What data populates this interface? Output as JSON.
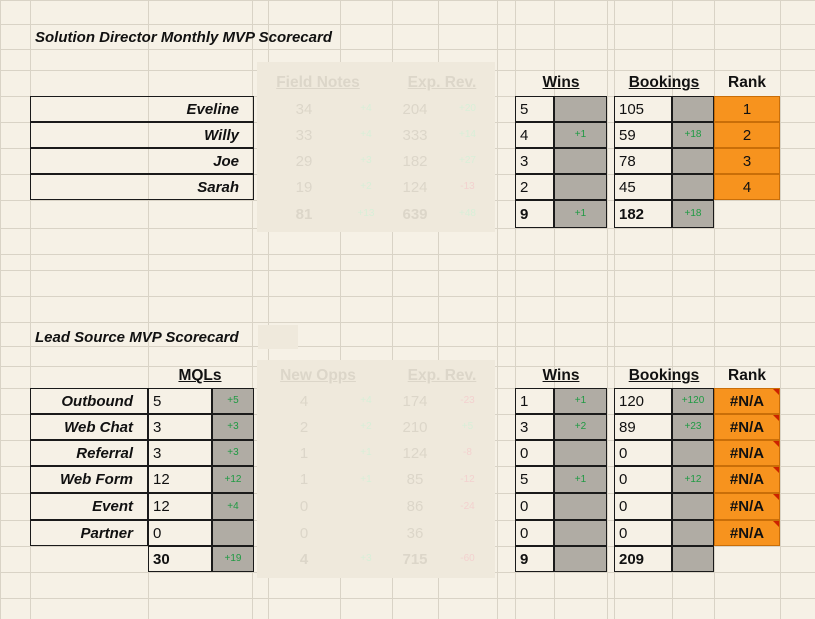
{
  "scorecard1": {
    "title": "Solution Director Monthly MVP Scorecard",
    "headers": {
      "field_notes": "Field Notes",
      "exp_rev": "Exp. Rev.",
      "wins": "Wins",
      "bookings": "Bookings",
      "rank": "Rank"
    },
    "rows": [
      {
        "name": "Eveline",
        "fn": "34",
        "fn_d": "+4",
        "er": "204",
        "er_d": "+20",
        "wins": "5",
        "wins_d": "",
        "book": "105",
        "book_d": "",
        "rank": "1"
      },
      {
        "name": "Willy",
        "fn": "33",
        "fn_d": "+4",
        "er": "333",
        "er_d": "+14",
        "wins": "4",
        "wins_d": "+1",
        "book": "59",
        "book_d": "+18",
        "rank": "2"
      },
      {
        "name": "Joe",
        "fn": "29",
        "fn_d": "+3",
        "er": "182",
        "er_d": "+27",
        "wins": "3",
        "wins_d": "",
        "book": "78",
        "book_d": "",
        "rank": "3"
      },
      {
        "name": "Sarah",
        "fn": "19",
        "fn_d": "+2",
        "er": "124",
        "er_d": "-13",
        "wins": "2",
        "wins_d": "",
        "book": "45",
        "book_d": "",
        "rank": "4"
      }
    ],
    "totals": {
      "fn": "81",
      "fn_d": "+13",
      "er": "639",
      "er_d": "+48",
      "wins": "9",
      "wins_d": "+1",
      "book": "182",
      "book_d": "+18"
    }
  },
  "scorecard2": {
    "title": "Lead Source MVP Scorecard",
    "headers": {
      "mqls": "MQLs",
      "new_opps": "New Opps",
      "exp_rev": "Exp. Rev.",
      "wins": "Wins",
      "bookings": "Bookings",
      "rank": "Rank"
    },
    "rows": [
      {
        "name": "Outbound",
        "mql": "5",
        "mql_d": "+5",
        "no": "4",
        "no_d": "+4",
        "er": "174",
        "er_d": "-23",
        "wins": "1",
        "wins_d": "+1",
        "book": "120",
        "book_d": "+120",
        "rank": "#N/A"
      },
      {
        "name": "Web Chat",
        "mql": "3",
        "mql_d": "+3",
        "no": "2",
        "no_d": "+2",
        "er": "210",
        "er_d": "+5",
        "wins": "3",
        "wins_d": "+2",
        "book": "89",
        "book_d": "+23",
        "rank": "#N/A"
      },
      {
        "name": "Referral",
        "mql": "3",
        "mql_d": "+3",
        "no": "1",
        "no_d": "+1",
        "er": "124",
        "er_d": "-8",
        "wins": "0",
        "wins_d": "",
        "book": "0",
        "book_d": "",
        "rank": "#N/A"
      },
      {
        "name": "Web Form",
        "mql": "12",
        "mql_d": "+12",
        "no": "1",
        "no_d": "+1",
        "er": "85",
        "er_d": "-12",
        "wins": "5",
        "wins_d": "+1",
        "book": "0",
        "book_d": "+12",
        "rank": "#N/A"
      },
      {
        "name": "Event",
        "mql": "12",
        "mql_d": "+4",
        "no": "0",
        "no_d": "",
        "er": "86",
        "er_d": "-24",
        "wins": "0",
        "wins_d": "",
        "book": "0",
        "book_d": "",
        "rank": "#N/A"
      },
      {
        "name": "Partner",
        "mql": "0",
        "mql_d": "",
        "no": "0",
        "no_d": "",
        "er": "36",
        "er_d": "",
        "wins": "0",
        "wins_d": "",
        "book": "0",
        "book_d": "",
        "rank": "#N/A"
      }
    ],
    "totals": {
      "mql": "30",
      "mql_d": "+19",
      "no": "4",
      "no_d": "+3",
      "er": "715",
      "er_d": "-60",
      "wins": "9",
      "wins_d": "",
      "book": "209",
      "book_d": ""
    }
  },
  "colors": {
    "background": "#f6f1e6",
    "gridline": "#d9d3c6",
    "rank_fill": "#f7931e",
    "delta_fill": "#b0aca4",
    "positive_delta": "#1f9a43",
    "error_marker": "#cc2200"
  }
}
